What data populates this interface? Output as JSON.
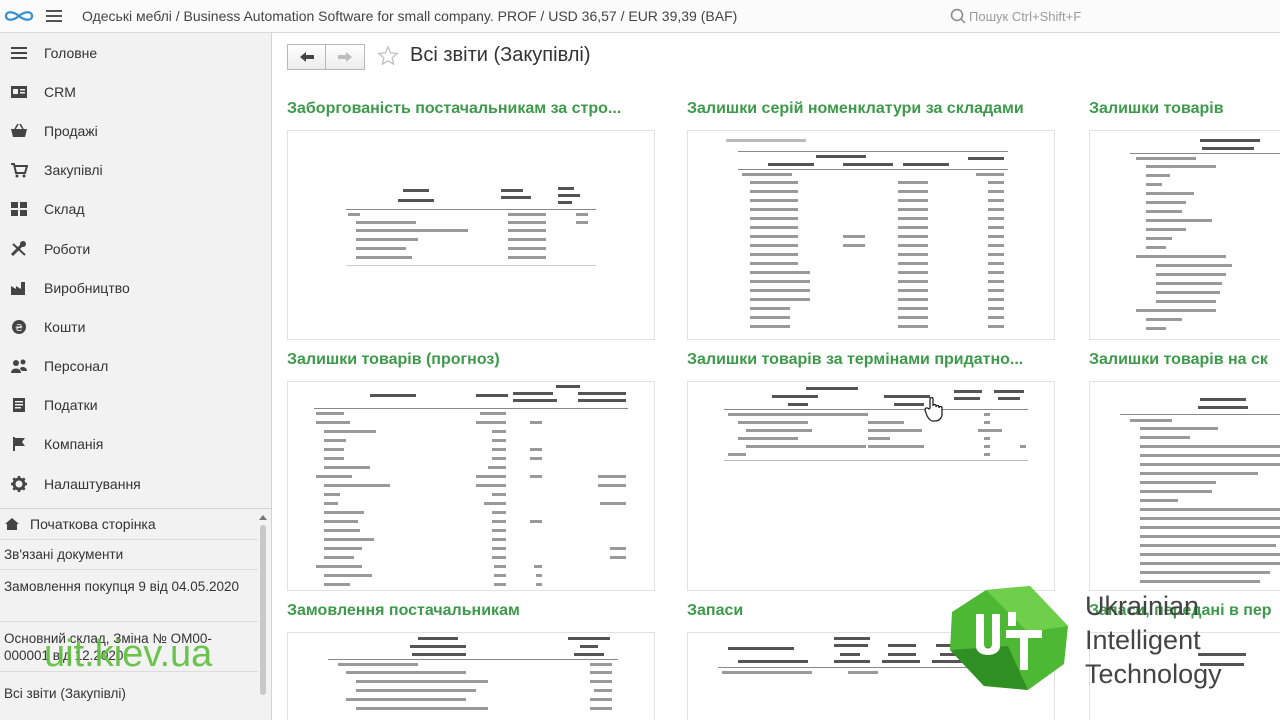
{
  "app": {
    "title": "Одеські меблі / Business Automation Software for small company. PROF / USD 36,57 / EUR 39,39  (BAF)",
    "search_placeholder": "Пошук Ctrl+Shift+F"
  },
  "sidebar": {
    "items": [
      {
        "label": "Головне",
        "icon": "list-icon"
      },
      {
        "label": "CRM",
        "icon": "contact-card-icon"
      },
      {
        "label": "Продажі",
        "icon": "basket-icon"
      },
      {
        "label": "Закупівлі",
        "icon": "cart-icon"
      },
      {
        "label": "Склад",
        "icon": "warehouse-grid-icon"
      },
      {
        "label": "Роботи",
        "icon": "tools-icon"
      },
      {
        "label": "Виробництво",
        "icon": "factory-icon"
      },
      {
        "label": "Кошти",
        "icon": "coin-icon"
      },
      {
        "label": "Персонал",
        "icon": "people-icon"
      },
      {
        "label": "Податки",
        "icon": "document-icon"
      },
      {
        "label": "Компанія",
        "icon": "flag-icon"
      },
      {
        "label": "Налаштування",
        "icon": "gear-icon"
      }
    ]
  },
  "history": {
    "home_label": "Початкова сторінка",
    "items": [
      "Зв'язані документи",
      "Замовлення покупця 9 від 04.05.2020",
      "Основний склад, Зміна № ОМ00-000001 від 12.2020",
      "Всі звіти (Закупівлі)"
    ]
  },
  "main": {
    "title": "Всі звіти (Закупівлі)",
    "cards": [
      {
        "title": "Заборгованість постачальникам за стро..."
      },
      {
        "title": "Залишки серій номенклатури за складами"
      },
      {
        "title": "Залишки товарів"
      },
      {
        "title": "Залишки товарів (прогноз)"
      },
      {
        "title": "Залишки товарів за термінами придатно..."
      },
      {
        "title": "Залишки товарів на ск"
      },
      {
        "title": "Замовлення постачальникам"
      },
      {
        "title": "Запаси"
      },
      {
        "title": "Запаси, передані в пер"
      }
    ]
  },
  "watermark": {
    "url": "uit.kiev.ua",
    "company_lines": [
      "Ukrainian",
      "Intelligent",
      "Technology"
    ]
  },
  "colors": {
    "accent_green": "#3d9a4a",
    "logo_green": "#5fc13e"
  }
}
